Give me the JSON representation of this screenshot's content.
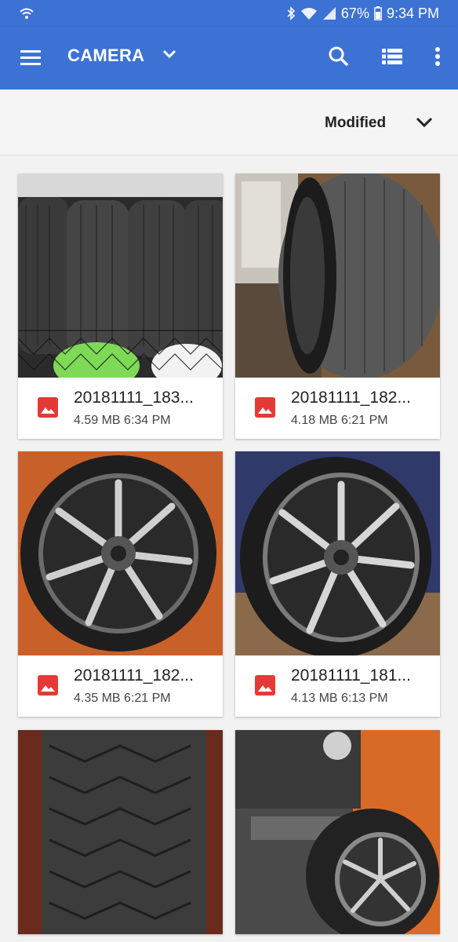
{
  "status": {
    "battery": "67%",
    "time": "9:34 PM"
  },
  "appbar": {
    "title": "CAMERA",
    "icons": [
      "menu-icon",
      "dropdown-chevron-icon",
      "search-icon",
      "list-view-icon",
      "more-vert-icon"
    ]
  },
  "sort": {
    "label": "Modified"
  },
  "files": [
    {
      "name": "20181111_183...",
      "size": "4.59 MB",
      "time": "6:34 PM",
      "thumb": "stacked-tires"
    },
    {
      "name": "20181111_182...",
      "size": "4.18 MB",
      "time": "6:21 PM",
      "thumb": "tire-side"
    },
    {
      "name": "20181111_182...",
      "size": "4.35 MB",
      "time": "6:21 PM",
      "thumb": "wheel-front"
    },
    {
      "name": "20181111_181...",
      "size": "4.13 MB",
      "time": "6:13 PM",
      "thumb": "wheel-angled"
    },
    {
      "name": "",
      "size": "",
      "time": "",
      "thumb": "tread-closeup"
    },
    {
      "name": "",
      "size": "",
      "time": "",
      "thumb": "tire-machine"
    }
  ],
  "colors": {
    "appbar": "#3c72d4",
    "image_icon": "#e53935"
  }
}
